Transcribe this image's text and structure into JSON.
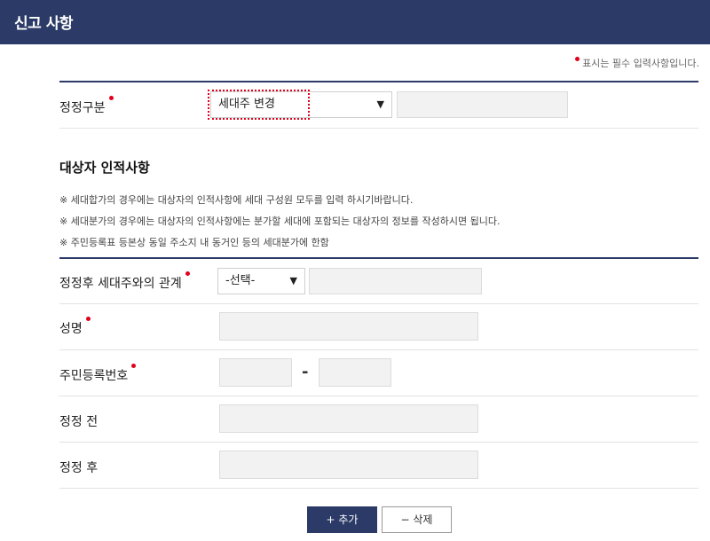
{
  "header": {
    "title": "신고 사항"
  },
  "required_note": "표시는 필수 입력사항입니다.",
  "correction_type": {
    "label": "정정구분",
    "selected": "세대주 변경",
    "text_value": ""
  },
  "section": {
    "title": "대상자 인적사항",
    "notes": [
      "※ 세대합가의 경우에는 대상자의 인적사항에 세대 구성원 모두를 입력 하시기바랍니다.",
      "※ 세대분가의 경우에는 대상자의 인적사항에는 분가할 세대에 포함되는 대상자의 정보를 작성하시면 됩니다.",
      "※ 주민등록표 등본상 동일 주소지 내 동거인 등의 세대분가에 한함"
    ]
  },
  "form": {
    "relation": {
      "label": "정정후 세대주와의 관계",
      "selected": "-선택-",
      "text_value": ""
    },
    "name": {
      "label": "성명",
      "value": ""
    },
    "rrn": {
      "label": "주민등록번호",
      "separator": "-",
      "front": "",
      "back": ""
    },
    "before": {
      "label": "정정 전",
      "value": ""
    },
    "after": {
      "label": "정정 후",
      "value": ""
    }
  },
  "buttons": {
    "add": "+ 추가",
    "delete": "− 삭제"
  },
  "colors": {
    "header_bg": "#2b3a67",
    "required_dot": "#e0001b",
    "field_bg": "#f2f2f2"
  }
}
